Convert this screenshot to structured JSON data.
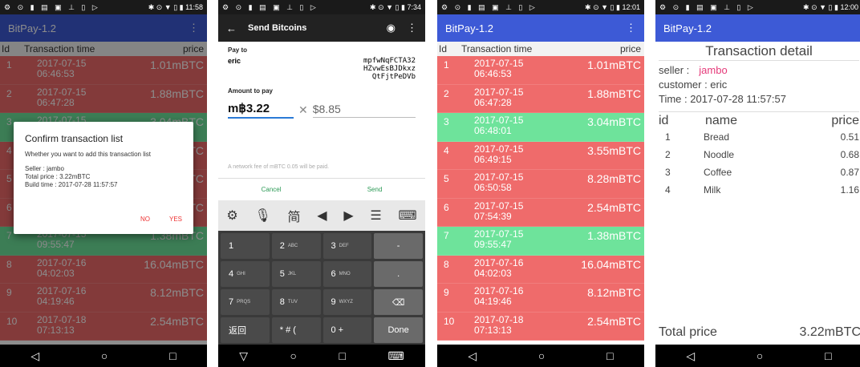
{
  "status": {
    "p1_time": "11:58",
    "p2_time": "7:34",
    "p3_time": "12:01",
    "p4_time": "12:00",
    "left_icons": "⚙ ⊙ ▮ ▤ ▣ ⊥ ▯ ▷",
    "right_icons": "✱ ⊙ ▼ ▯ ▮"
  },
  "app": {
    "title": "BitPay-1.2",
    "menu_icon": "⋮"
  },
  "list_header": {
    "id": "Id",
    "time": "Transaction time",
    "price": "price"
  },
  "transactions": [
    {
      "id": "1",
      "date": "2017-07-15",
      "time": "06:46:53",
      "price": "1.01mBTC",
      "color": "red"
    },
    {
      "id": "2",
      "date": "2017-07-15",
      "time": "06:47:28",
      "price": "1.88mBTC",
      "color": "red"
    },
    {
      "id": "3",
      "date": "2017-07-15",
      "time": "06:48:01",
      "price": "3.04mBTC",
      "color": "green"
    },
    {
      "id": "4",
      "date": "2017-07-15",
      "time": "06:49:15",
      "price": "3.55mBTC",
      "color": "red"
    },
    {
      "id": "5",
      "date": "2017-07-15",
      "time": "06:50:58",
      "price": "8.28mBTC",
      "color": "red"
    },
    {
      "id": "6",
      "date": "2017-07-15",
      "time": "07:54:39",
      "price": "2.54mBTC",
      "color": "red"
    },
    {
      "id": "7",
      "date": "2017-07-15",
      "time": "09:55:47",
      "price": "1.38mBTC",
      "color": "green"
    },
    {
      "id": "8",
      "date": "2017-07-16",
      "time": "04:02:03",
      "price": "16.04mBTC",
      "color": "red"
    },
    {
      "id": "9",
      "date": "2017-07-16",
      "time": "04:19:46",
      "price": "8.12mBTC",
      "color": "red"
    },
    {
      "id": "10",
      "date": "2017-07-18",
      "time": "07:13:13",
      "price": "2.54mBTC",
      "color": "red"
    }
  ],
  "dialog": {
    "title": "Confirm transaction list",
    "text": "Whether you want to add this transaction list",
    "seller": "Seller : jambo",
    "total": "Total price : 3.22mBTC",
    "build": "Build time : 2017-07-28 11:57:57",
    "no": "NO",
    "yes": "YES"
  },
  "send": {
    "back_icon": "←",
    "title": "Send Bitcoins",
    "camera_icon": "◉",
    "pay_to_label": "Pay to",
    "recipient": "eric",
    "address": "mpfwNqFCTA32\nHZvwEsBJDkxz\nQtFjtPeDVb",
    "amount_label": "Amount to pay",
    "amount_btc": "m฿3.22",
    "times": "✕",
    "amount_fiat": "$8.85",
    "fee_note": "A network fee of mBTC 0.05 will be paid.",
    "cancel": "Cancel",
    "send": "Send"
  },
  "keyboard": {
    "tools": [
      "⚙",
      "🎙",
      "简",
      "◀",
      "▶",
      "☰",
      "⌨"
    ],
    "keys": [
      {
        "main": "1",
        "sub": ""
      },
      {
        "main": "2",
        "sub": "ABC"
      },
      {
        "main": "3",
        "sub": "DEF"
      },
      {
        "main": "-",
        "sub": ""
      },
      {
        "main": "4",
        "sub": "GHI"
      },
      {
        "main": "5",
        "sub": "JKL"
      },
      {
        "main": "6",
        "sub": "MNO"
      },
      {
        "main": ".",
        "sub": ""
      },
      {
        "main": "7",
        "sub": "PRQS"
      },
      {
        "main": "8",
        "sub": "TUV"
      },
      {
        "main": "9",
        "sub": "WXYZ"
      },
      {
        "main": "⌫",
        "sub": ""
      },
      {
        "main": "返回",
        "sub": ""
      },
      {
        "main": "* # (",
        "sub": ""
      },
      {
        "main": "0 +",
        "sub": ""
      },
      {
        "main": "Done",
        "sub": ""
      }
    ]
  },
  "nav": {
    "back": "◁",
    "home": "○",
    "recent": "□",
    "back2": "▽",
    "kbd": "⌨"
  },
  "detail": {
    "heading": "Transaction detail",
    "seller_label": "seller :",
    "seller_value": "jambo",
    "customer": "customer : eric",
    "time": "Time :  2017-07-28 11:57:57",
    "col_id": "id",
    "col_name": "name",
    "col_price": "price",
    "items": [
      {
        "id": "1",
        "name": "Bread",
        "price": "0.51"
      },
      {
        "id": "2",
        "name": "Noodle",
        "price": "0.68"
      },
      {
        "id": "3",
        "name": "Coffee",
        "price": "0.87"
      },
      {
        "id": "4",
        "name": "Milk",
        "price": "1.16"
      }
    ],
    "total_label": "Total price",
    "total_value": "3.22mBTC"
  },
  "colors": {
    "appbar": "#3d5ad6",
    "row_red": "#ef6b6b",
    "row_green": "#6ee39b",
    "send_green": "#2c9a56",
    "seller_pink": "#e53a7a"
  }
}
